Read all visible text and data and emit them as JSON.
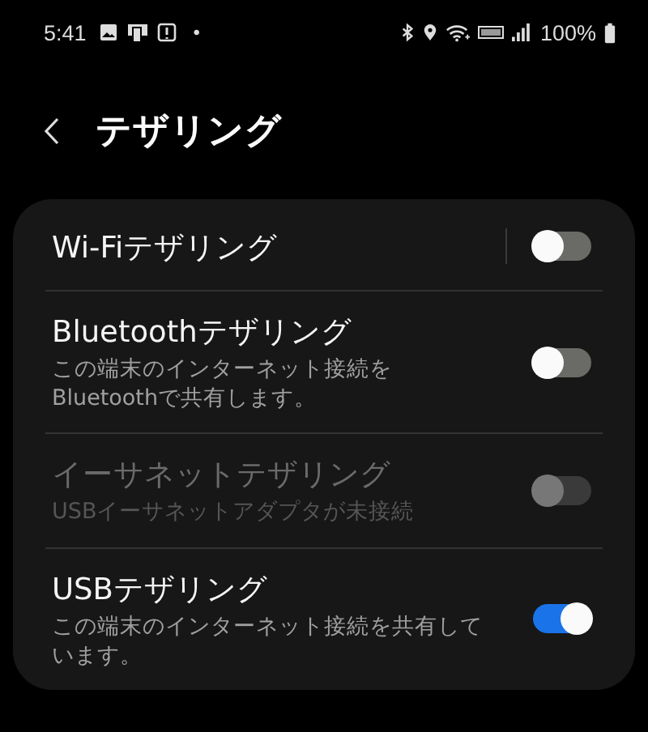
{
  "status_bar": {
    "time": "5:41",
    "dot": "•",
    "battery": "100%"
  },
  "header": {
    "title": "テザリング"
  },
  "items": [
    {
      "title": "Wi-Fiテザリング",
      "on": false,
      "disabled": false,
      "divider": true
    },
    {
      "title": "Bluetoothテザリング",
      "subtitle": "この端末のインターネット接続を\nBluetoothで共有します。",
      "on": false,
      "disabled": false,
      "divider": false
    },
    {
      "title": "イーサネットテザリング",
      "subtitle": "USBイーサネットアダプタが未接続",
      "on": false,
      "disabled": true,
      "divider": false
    },
    {
      "title": "USBテザリング",
      "subtitle": "この端末のインターネット接続を共有しています。",
      "on": true,
      "disabled": false,
      "divider": false
    }
  ]
}
